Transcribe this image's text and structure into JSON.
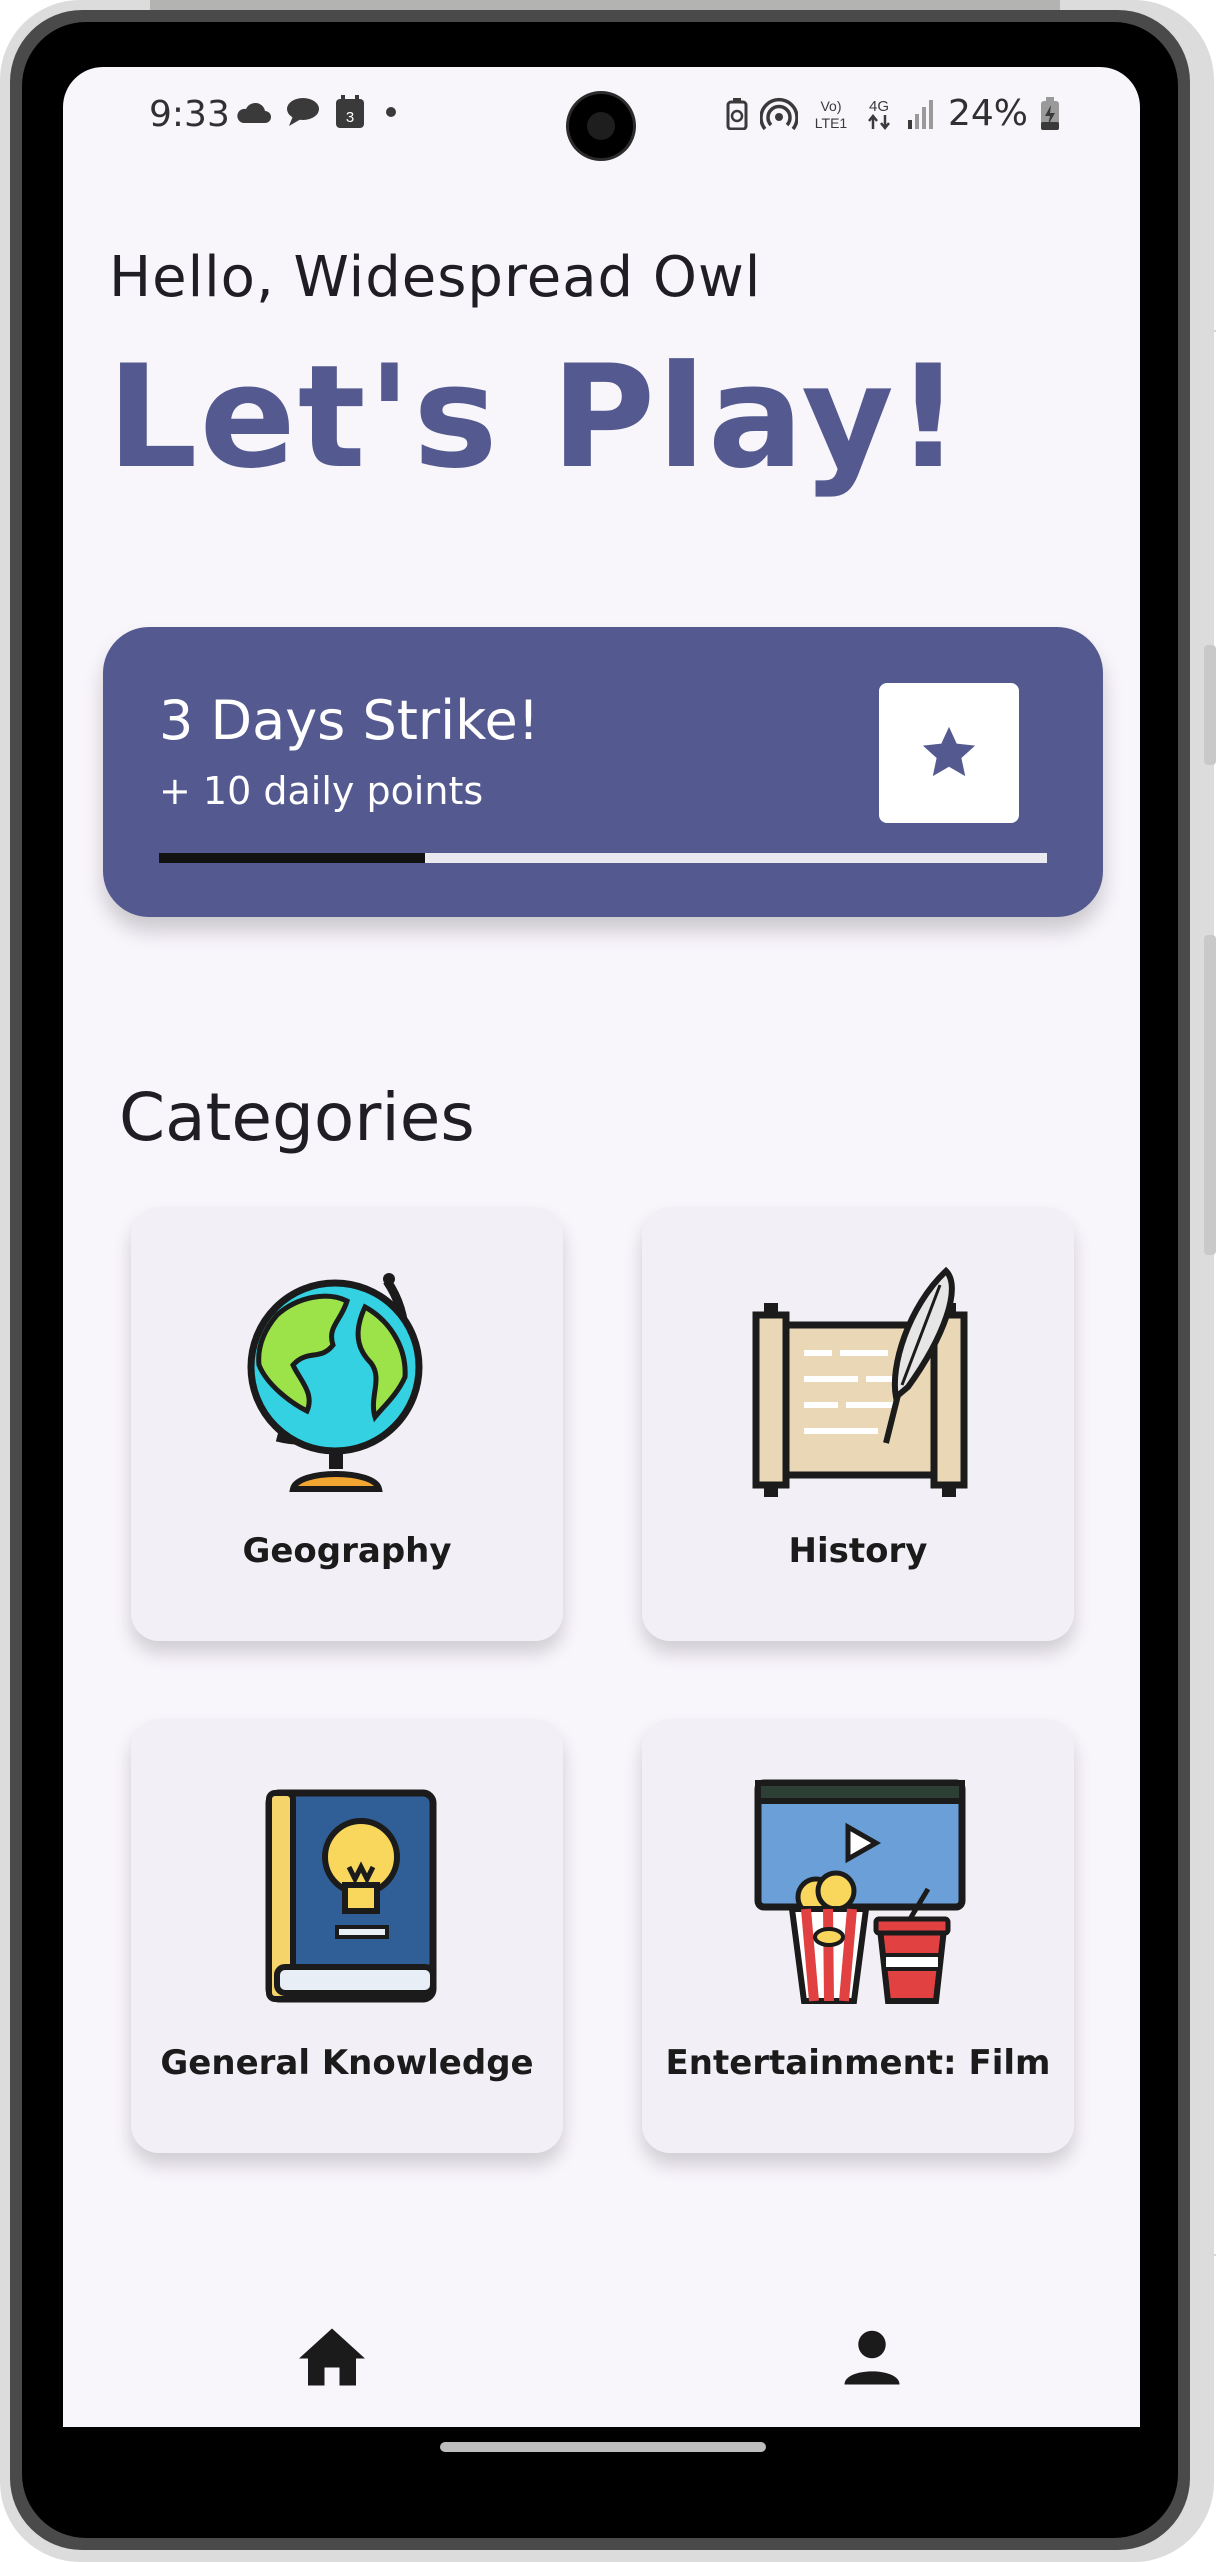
{
  "status_bar": {
    "time": "9:33",
    "calendar_day": "3",
    "network_labels": [
      "Vo)",
      "LTE1",
      "4G"
    ],
    "battery_percent": "24%",
    "icons": [
      "cloud-icon",
      "chat-bubble-icon",
      "calendar-icon",
      "dot-icon",
      "battery-saver-icon",
      "hotspot-icon",
      "volte-icon",
      "4g-icon",
      "signal-icon",
      "battery-charging-icon"
    ]
  },
  "header": {
    "greeting": "Hello, Widespread Owl",
    "headline": "Let's Play!"
  },
  "streak": {
    "title": "3 Days Strike!",
    "subtitle": "+ 10 daily points",
    "progress": 0.3,
    "icon": "star-icon"
  },
  "categories": {
    "title": "Categories",
    "items": [
      {
        "label": "Geography",
        "icon": "globe-icon"
      },
      {
        "label": "History",
        "icon": "scroll-quill-icon"
      },
      {
        "label": "General Knowledge",
        "icon": "lightbulb-book-icon"
      },
      {
        "label": "Entertainment: Film",
        "icon": "movie-popcorn-icon"
      }
    ]
  },
  "bottom_nav": {
    "items": [
      {
        "icon": "home-icon"
      },
      {
        "icon": "profile-icon"
      }
    ]
  },
  "colors": {
    "accent": "#545a90",
    "background": "#f8f5fb",
    "card": "#f2f0f6"
  }
}
